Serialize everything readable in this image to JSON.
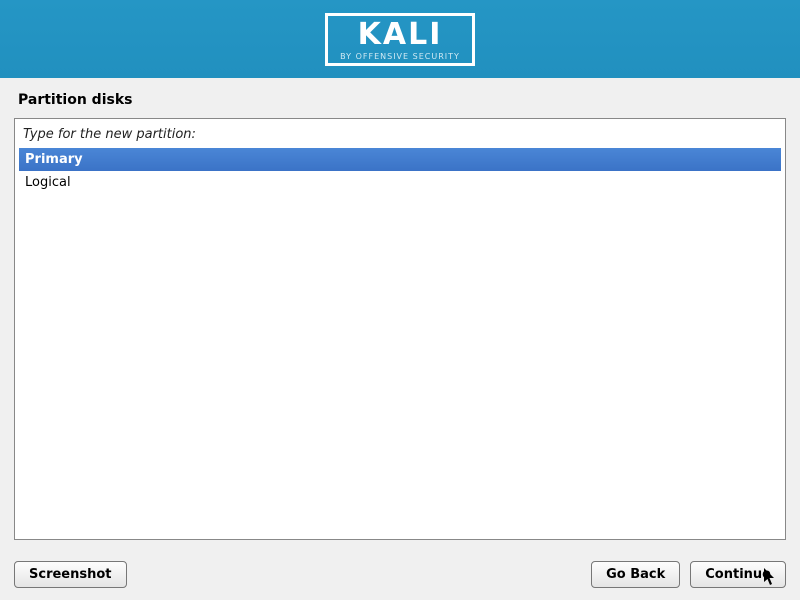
{
  "header": {
    "logo_text": "KALI",
    "logo_subtext": "BY OFFENSIVE SECURITY"
  },
  "page": {
    "title": "Partition disks",
    "prompt": "Type for the new partition:"
  },
  "options": [
    {
      "label": "Primary",
      "selected": true
    },
    {
      "label": "Logical",
      "selected": false
    }
  ],
  "buttons": {
    "screenshot": "Screenshot",
    "go_back": "Go Back",
    "continue": "Continue"
  }
}
